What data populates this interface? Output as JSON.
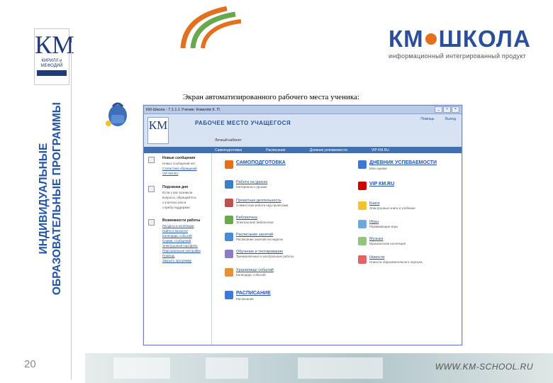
{
  "brand": {
    "title_left": "КМ",
    "title_right": "ШКОЛА",
    "subtitle": "информационный интегрированный продукт",
    "colors": {
      "blue": "#2b4f9a",
      "orange": "#e2701f",
      "green": "#6aa84f"
    }
  },
  "logo": {
    "letters": "КМ",
    "line1": "КИРИЛЛ и",
    "line2": "МЕФОДИЙ"
  },
  "side_band": {
    "line1": "ИНДИВИДУАЛЬНЫЕ",
    "line2": "ОБРАЗОВАТЕЛЬНЫЕ ПРОГРАММЫ"
  },
  "page_number": "20",
  "caption": "Экран автоматизированного рабочего места ученика:",
  "website": "WWW.KM-SCHOOL.RU",
  "app": {
    "window_title": "КМ-Школа - 7.1.1.1 Ученик: Ковалёв К. П.",
    "header": {
      "title": "РАБОЧЕЕ МЕСТО УЧАЩЕГОСЯ",
      "links": [
        "Помощь",
        "Выход"
      ],
      "user": "Личный кабинет"
    },
    "tabs": [
      "Самоподготовка",
      "Расписание",
      "Дневник успеваемости",
      "VIP КМ.RU"
    ],
    "sidebar": {
      "groups": [
        {
          "title": "Новые сообщения",
          "items": [
            {
              "text": "Новых сообщений нет",
              "link": false
            },
            {
              "text": "Статистика обращений",
              "link": true
            },
            {
              "text": "VIP КМ.RU",
              "link": true
            }
          ]
        },
        {
          "title": "Подсказка дня",
          "items": [
            {
              "text": "Если у вас возникли",
              "link": false
            },
            {
              "text": "вопросы, обращайтесь",
              "link": false
            },
            {
              "text": "к учителю или в",
              "link": false
            },
            {
              "text": "службу поддержки",
              "link": false
            }
          ]
        },
        {
          "title": "Возможности работы",
          "items": [
            {
              "text": "Ресурсы и коллекции",
              "link": true
            },
            {
              "text": "Найти в каталоге",
              "link": true
            },
            {
              "text": "Календарь событий",
              "link": true
            },
            {
              "text": "Сервис сообщений",
              "link": true
            },
            {
              "text": "Электронный портфель",
              "link": true
            },
            {
              "text": "Персональные настройки",
              "link": true
            },
            {
              "text": "Помощь",
              "link": true
            },
            {
              "text": "Закрыть программу",
              "link": true
            }
          ]
        }
      ]
    },
    "modules_left": [
      {
        "title": "САМОПОДГОТОВКА",
        "desc": "",
        "big": true,
        "color": "#e2701f"
      },
      {
        "title": "Работа на уроках",
        "desc": "Материалы к урокам",
        "big": false,
        "color": "#3a7fc8"
      },
      {
        "title": "Проектная деятельность",
        "desc": "Совместная работа над проектами",
        "big": false,
        "color": "#c0504d"
      },
      {
        "title": "Библиотека",
        "desc": "Электронная библиотека",
        "big": false,
        "color": "#6aa84f"
      },
      {
        "title": "Расписание занятий",
        "desc": "Расписание занятий на неделю",
        "big": false,
        "color": "#4b8bd6"
      },
      {
        "title": "Обучение и тестирование",
        "desc": "Тренировочные и контрольные работы",
        "big": false,
        "color": "#8e7cc3"
      },
      {
        "title": "Хранилище событий",
        "desc": "Календарь событий",
        "big": false,
        "color": "#e69138"
      },
      {
        "title": "РАСПИСАНИЕ",
        "desc": "Расписание",
        "big": true,
        "color": "#3c78d8"
      }
    ],
    "modules_right": [
      {
        "title": "ДНЕВНИК УСПЕВАЕМОСТИ",
        "desc": "Мои оценки",
        "big": true,
        "color": "#3c78d8"
      },
      {
        "title": "VIP КМ.RU",
        "desc": "",
        "big": true,
        "color": "#cc0000"
      },
      {
        "title": "Книги",
        "desc": "Электронные книги и учебники",
        "big": false,
        "color": "#f1c232"
      },
      {
        "title": "Игры",
        "desc": "Развивающие игры",
        "big": false,
        "color": "#6fa8dc"
      },
      {
        "title": "Музыка",
        "desc": "Музыкальная коллекция",
        "big": false,
        "color": "#93c47d"
      },
      {
        "title": "Новости",
        "desc": "Новости образовательного портала",
        "big": false,
        "color": "#e06666"
      }
    ]
  }
}
